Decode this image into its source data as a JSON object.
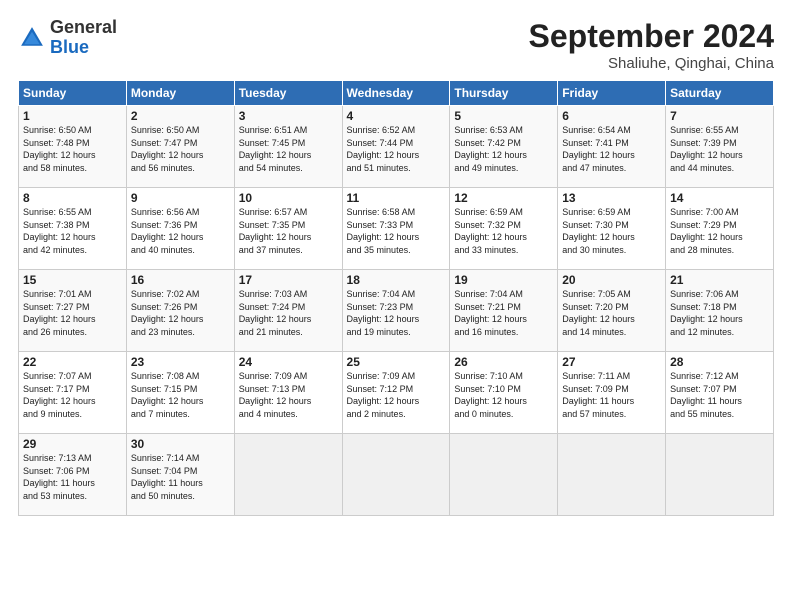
{
  "header": {
    "logo_general": "General",
    "logo_blue": "Blue",
    "title": "September 2024",
    "subtitle": "Shaliuhe, Qinghai, China"
  },
  "days_of_week": [
    "Sunday",
    "Monday",
    "Tuesday",
    "Wednesday",
    "Thursday",
    "Friday",
    "Saturday"
  ],
  "weeks": [
    [
      {
        "day": "1",
        "info": "Sunrise: 6:50 AM\nSunset: 7:48 PM\nDaylight: 12 hours\nand 58 minutes."
      },
      {
        "day": "2",
        "info": "Sunrise: 6:50 AM\nSunset: 7:47 PM\nDaylight: 12 hours\nand 56 minutes."
      },
      {
        "day": "3",
        "info": "Sunrise: 6:51 AM\nSunset: 7:45 PM\nDaylight: 12 hours\nand 54 minutes."
      },
      {
        "day": "4",
        "info": "Sunrise: 6:52 AM\nSunset: 7:44 PM\nDaylight: 12 hours\nand 51 minutes."
      },
      {
        "day": "5",
        "info": "Sunrise: 6:53 AM\nSunset: 7:42 PM\nDaylight: 12 hours\nand 49 minutes."
      },
      {
        "day": "6",
        "info": "Sunrise: 6:54 AM\nSunset: 7:41 PM\nDaylight: 12 hours\nand 47 minutes."
      },
      {
        "day": "7",
        "info": "Sunrise: 6:55 AM\nSunset: 7:39 PM\nDaylight: 12 hours\nand 44 minutes."
      }
    ],
    [
      {
        "day": "8",
        "info": "Sunrise: 6:55 AM\nSunset: 7:38 PM\nDaylight: 12 hours\nand 42 minutes."
      },
      {
        "day": "9",
        "info": "Sunrise: 6:56 AM\nSunset: 7:36 PM\nDaylight: 12 hours\nand 40 minutes."
      },
      {
        "day": "10",
        "info": "Sunrise: 6:57 AM\nSunset: 7:35 PM\nDaylight: 12 hours\nand 37 minutes."
      },
      {
        "day": "11",
        "info": "Sunrise: 6:58 AM\nSunset: 7:33 PM\nDaylight: 12 hours\nand 35 minutes."
      },
      {
        "day": "12",
        "info": "Sunrise: 6:59 AM\nSunset: 7:32 PM\nDaylight: 12 hours\nand 33 minutes."
      },
      {
        "day": "13",
        "info": "Sunrise: 6:59 AM\nSunset: 7:30 PM\nDaylight: 12 hours\nand 30 minutes."
      },
      {
        "day": "14",
        "info": "Sunrise: 7:00 AM\nSunset: 7:29 PM\nDaylight: 12 hours\nand 28 minutes."
      }
    ],
    [
      {
        "day": "15",
        "info": "Sunrise: 7:01 AM\nSunset: 7:27 PM\nDaylight: 12 hours\nand 26 minutes."
      },
      {
        "day": "16",
        "info": "Sunrise: 7:02 AM\nSunset: 7:26 PM\nDaylight: 12 hours\nand 23 minutes."
      },
      {
        "day": "17",
        "info": "Sunrise: 7:03 AM\nSunset: 7:24 PM\nDaylight: 12 hours\nand 21 minutes."
      },
      {
        "day": "18",
        "info": "Sunrise: 7:04 AM\nSunset: 7:23 PM\nDaylight: 12 hours\nand 19 minutes."
      },
      {
        "day": "19",
        "info": "Sunrise: 7:04 AM\nSunset: 7:21 PM\nDaylight: 12 hours\nand 16 minutes."
      },
      {
        "day": "20",
        "info": "Sunrise: 7:05 AM\nSunset: 7:20 PM\nDaylight: 12 hours\nand 14 minutes."
      },
      {
        "day": "21",
        "info": "Sunrise: 7:06 AM\nSunset: 7:18 PM\nDaylight: 12 hours\nand 12 minutes."
      }
    ],
    [
      {
        "day": "22",
        "info": "Sunrise: 7:07 AM\nSunset: 7:17 PM\nDaylight: 12 hours\nand 9 minutes."
      },
      {
        "day": "23",
        "info": "Sunrise: 7:08 AM\nSunset: 7:15 PM\nDaylight: 12 hours\nand 7 minutes."
      },
      {
        "day": "24",
        "info": "Sunrise: 7:09 AM\nSunset: 7:13 PM\nDaylight: 12 hours\nand 4 minutes."
      },
      {
        "day": "25",
        "info": "Sunrise: 7:09 AM\nSunset: 7:12 PM\nDaylight: 12 hours\nand 2 minutes."
      },
      {
        "day": "26",
        "info": "Sunrise: 7:10 AM\nSunset: 7:10 PM\nDaylight: 12 hours\nand 0 minutes."
      },
      {
        "day": "27",
        "info": "Sunrise: 7:11 AM\nSunset: 7:09 PM\nDaylight: 11 hours\nand 57 minutes."
      },
      {
        "day": "28",
        "info": "Sunrise: 7:12 AM\nSunset: 7:07 PM\nDaylight: 11 hours\nand 55 minutes."
      }
    ],
    [
      {
        "day": "29",
        "info": "Sunrise: 7:13 AM\nSunset: 7:06 PM\nDaylight: 11 hours\nand 53 minutes."
      },
      {
        "day": "30",
        "info": "Sunrise: 7:14 AM\nSunset: 7:04 PM\nDaylight: 11 hours\nand 50 minutes."
      },
      {
        "day": "",
        "info": ""
      },
      {
        "day": "",
        "info": ""
      },
      {
        "day": "",
        "info": ""
      },
      {
        "day": "",
        "info": ""
      },
      {
        "day": "",
        "info": ""
      }
    ]
  ]
}
